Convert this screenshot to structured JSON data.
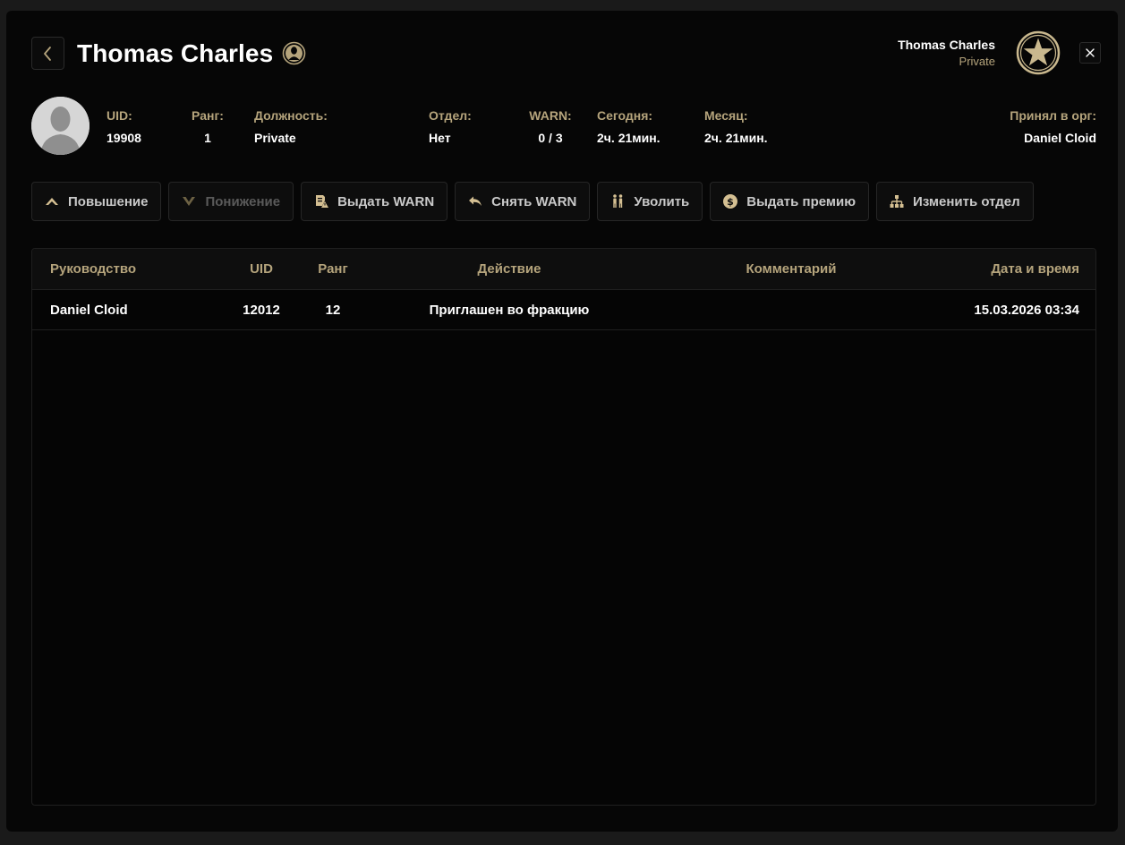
{
  "header": {
    "title": "Thomas Charles",
    "back_icon": "chevron-left-icon",
    "profile_icon": "person-badge-icon"
  },
  "current_user": {
    "name": "Thomas Charles",
    "rank": "Private",
    "badge_icon": "star-badge-icon",
    "close_icon": "close-icon"
  },
  "profile": {
    "uid_label": "UID:",
    "uid": "19908",
    "rank_label": "Ранг:",
    "rank": "1",
    "position_label": "Должность:",
    "position": "Private",
    "department_label": "Отдел:",
    "department": "Нет",
    "warn_label": "WARN:",
    "warn": "0 / 3",
    "today_label": "Сегодня:",
    "today": "2ч. 21мин.",
    "month_label": "Месяц:",
    "month": "2ч. 21мин.",
    "accepted_label": "Принял в орг:",
    "accepted_by": "Daniel Cloid"
  },
  "actions": [
    {
      "label": "Повышение",
      "icon": "chevron-up-icon",
      "enabled": true
    },
    {
      "label": "Понижение",
      "icon": "chevron-down-icon",
      "enabled": false
    },
    {
      "label": "Выдать WARN",
      "icon": "document-warning-icon",
      "enabled": true
    },
    {
      "label": "Снять WARN",
      "icon": "undo-arrow-icon",
      "enabled": true
    },
    {
      "label": "Уволить",
      "icon": "fire-person-icon",
      "enabled": true
    },
    {
      "label": "Выдать премию",
      "icon": "dollar-coin-icon",
      "enabled": true
    },
    {
      "label": "Изменить отдел",
      "icon": "org-chart-icon",
      "enabled": true
    }
  ],
  "table": {
    "columns": [
      "Руководство",
      "UID",
      "Ранг",
      "Действие",
      "Комментарий",
      "Дата и время"
    ],
    "rows": [
      [
        "Daniel Cloid",
        "12012",
        "12",
        "Приглашен во фракцию",
        "",
        "15.03.2026 03:34"
      ]
    ]
  },
  "colors": {
    "accent": "#b5a47c",
    "background": "#060606",
    "text": "#ffffff"
  }
}
